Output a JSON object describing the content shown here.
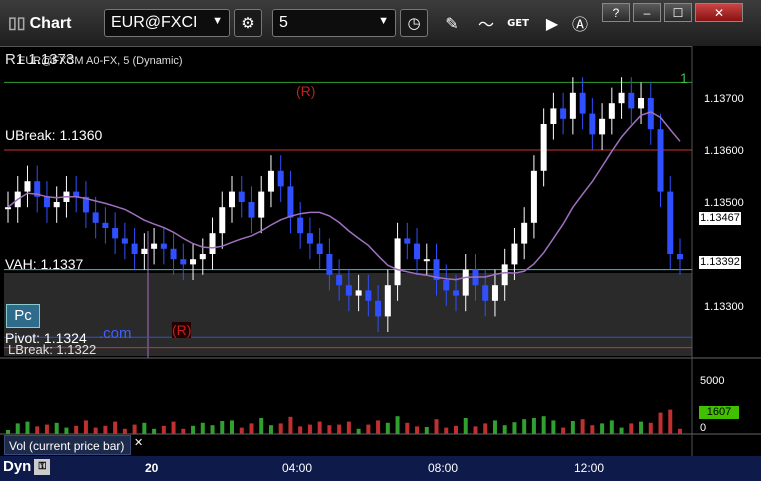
{
  "window": {
    "title": "Chart"
  },
  "toolbar": {
    "symbol": "EUR@FXCI",
    "interval": "5",
    "get_label": "GET"
  },
  "window_buttons": {
    "help": "?",
    "minimize": "–",
    "maximize": "☐",
    "close": "✕"
  },
  "chart": {
    "header_label": "EUR@FXCM A0-FX, 5 (Dynamic)",
    "header_overlay": "R1 1.1373",
    "levels": [
      {
        "label": "UBreak: 1.1360",
        "price": 1.136,
        "color": "#d03030"
      },
      {
        "label": "VAH: 1.1337",
        "price": 1.1337,
        "color": "#40c0c0"
      },
      {
        "label": "Pivot: 1.1324",
        "price": 1.1324,
        "color": "#3050d0"
      },
      {
        "label": "LBreak: 1.1322",
        "price": 1.1322,
        "color": "#d03030"
      }
    ],
    "r1_price": 1.1373,
    "pivot_overlay": ".com",
    "r_markers": [
      "(R)",
      "(R)"
    ],
    "pc_label": "Pc",
    "corner_label": "1",
    "price_ticks": [
      "1.13700",
      "1.13600",
      "1.13500",
      "1.13300"
    ],
    "price_tick_values": [
      1.137,
      1.136,
      1.135,
      1.133
    ],
    "ma_tag": "1.13467",
    "last_tag": "1.13392",
    "ma_color": "#a070c0",
    "time_ticks": [
      "20",
      "04:00",
      "08:00",
      "12:00"
    ]
  },
  "volume": {
    "panel_label": "Vol (current price bar)",
    "close_icon": "✕",
    "ticks": [
      "5000",
      "0"
    ],
    "last_tag": "1607",
    "last_tag_color": "#40c000"
  },
  "bottombar": {
    "dyn_label": "Dyn"
  },
  "chart_data": {
    "type": "line",
    "title": "",
    "series": [
      {
        "name": "",
        "values": [
          1.1349,
          1.1352,
          1.1354,
          1.1351,
          1.1349,
          1.135,
          1.1352,
          1.1351,
          1.1348,
          1.1346,
          1.1345,
          1.1343,
          1.1342,
          1.134,
          1.1341,
          1.1342,
          1.1341,
          1.1339,
          1.1338,
          1.1339,
          1.134,
          1.1344,
          1.1349,
          1.1352,
          1.135,
          1.1347,
          1.1352,
          1.1356,
          1.1353,
          1.1347,
          1.1344,
          1.1342,
          1.134,
          1.1336,
          1.1334,
          1.1332,
          1.1333,
          1.1331,
          1.1328,
          1.1334,
          1.1343,
          1.1342,
          1.1339,
          1.1339,
          1.1335,
          1.1333,
          1.1332,
          1.1337,
          1.1334,
          1.1331,
          1.1334,
          1.1338,
          1.1342,
          1.1346,
          1.1356,
          1.1365,
          1.1368,
          1.1366,
          1.1371,
          1.1367,
          1.1363,
          1.1366,
          1.1369,
          1.1371,
          1.1368,
          1.137,
          1.1364,
          1.1352,
          1.134,
          1.1339
        ]
      }
    ],
    "ylim": [
      1.132,
      1.138
    ]
  }
}
